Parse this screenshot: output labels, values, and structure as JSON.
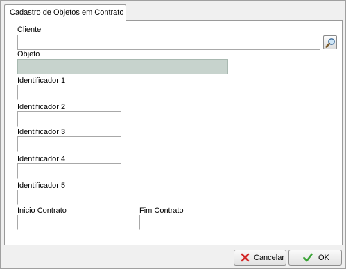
{
  "tab": {
    "label": "Cadastro de Objetos em Contrato"
  },
  "fields": {
    "cliente": {
      "label": "Cliente",
      "value": ""
    },
    "objeto": {
      "label": "Objeto",
      "value": ""
    },
    "identificador1": {
      "label": "Identificador 1",
      "value": ""
    },
    "identificador2": {
      "label": "Identificador 2",
      "value": ""
    },
    "identificador3": {
      "label": "Identificador 3",
      "value": ""
    },
    "identificador4": {
      "label": "Identificador 4",
      "value": ""
    },
    "identificador5": {
      "label": "Identificador 5",
      "value": ""
    },
    "inicio_contrato": {
      "label": "Inicio Contrato",
      "value": ""
    },
    "fim_contrato": {
      "label": "Fim Contrato",
      "value": ""
    }
  },
  "buttons": {
    "cancelar": {
      "label": "Cancelar",
      "icon": "x-icon"
    },
    "ok": {
      "label": "OK",
      "icon": "check-icon"
    },
    "lookup": {
      "icon": "magnifier-icon"
    }
  },
  "colors": {
    "readonly_bg": "#c7d3cd",
    "cancel_icon": "#d42a2a",
    "ok_icon": "#3aa336"
  }
}
